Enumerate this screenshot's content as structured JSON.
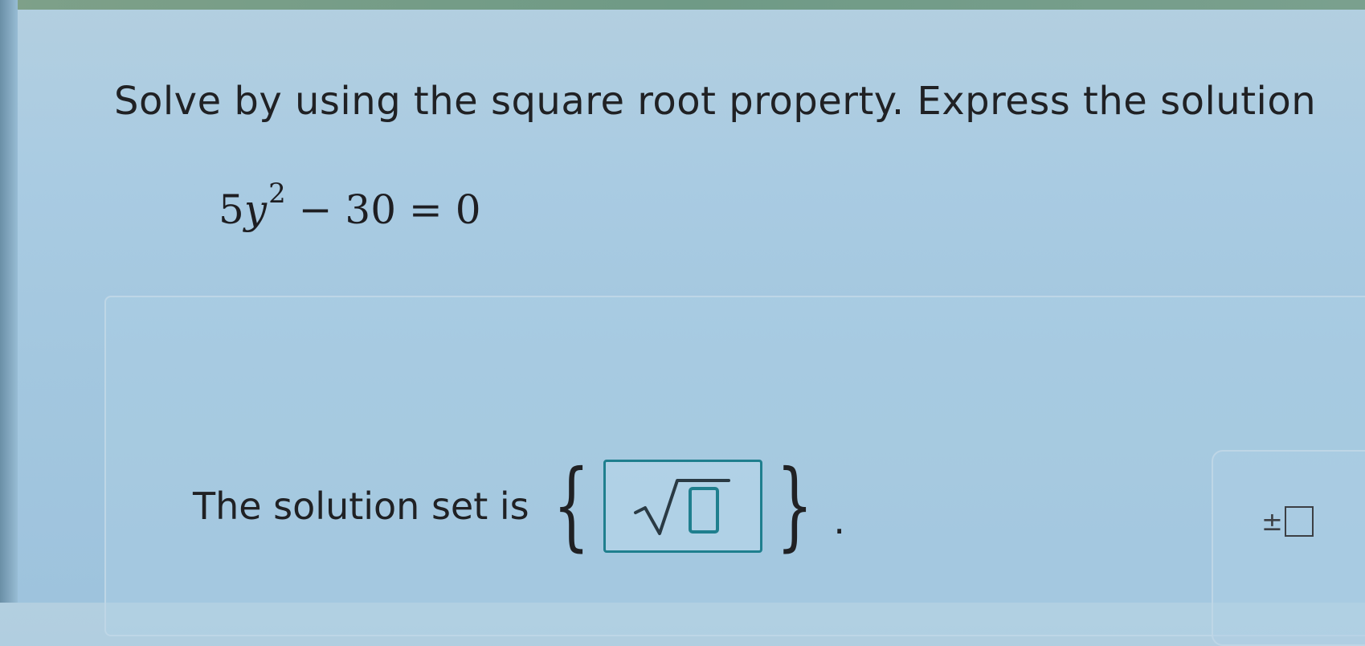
{
  "question": {
    "prompt": "Solve by using the square root property. Express the solution"
  },
  "equation": {
    "coefficient": "5",
    "variable": "y",
    "exponent": "2",
    "rest": " − 30 = 0"
  },
  "answer": {
    "label": "The solution set is",
    "open_brace": "{",
    "close_brace": "}",
    "period": "."
  },
  "palette": {
    "plus_minus_label": "±"
  },
  "colors": {
    "input_border": "#1f7f8e",
    "background": "#a9cbe2"
  },
  "icons": {
    "input_content": "square-root-icon",
    "palette_button": "plus-minus-template-icon"
  }
}
